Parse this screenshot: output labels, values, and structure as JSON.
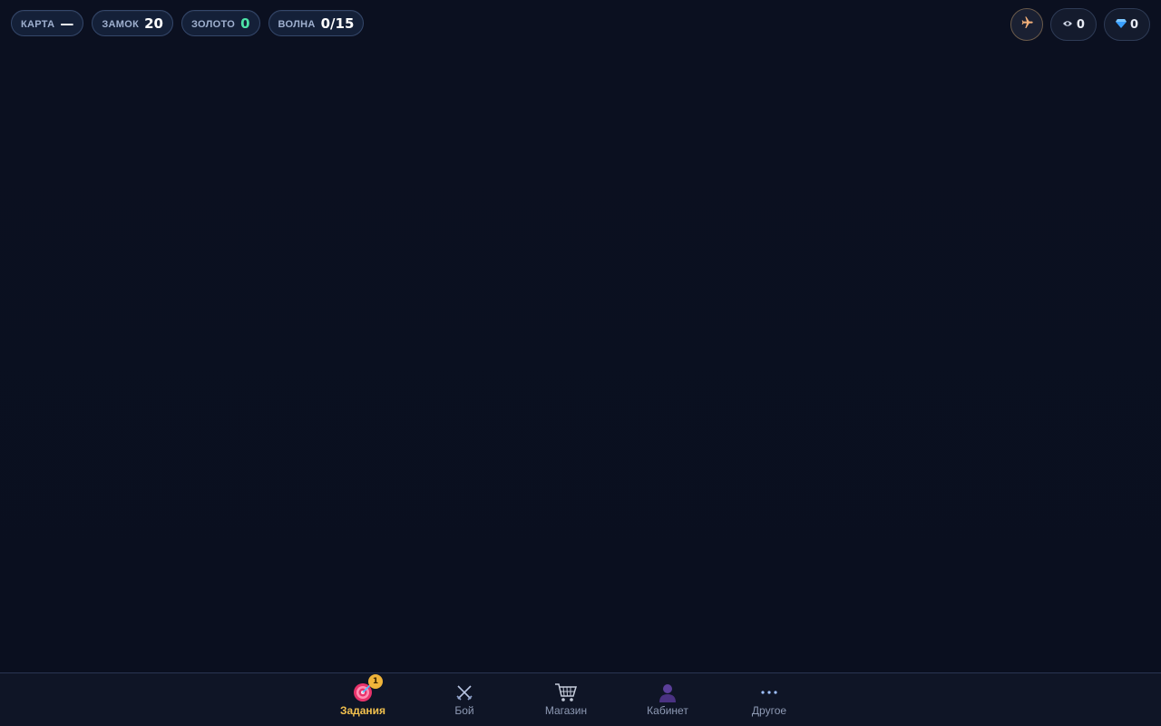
{
  "hud": {
    "stats": [
      {
        "label": "КАРТА",
        "value": "—"
      },
      {
        "label": "ЗАМОК",
        "value": "20"
      },
      {
        "label": "ЗОЛОТО",
        "value": "0"
      },
      {
        "label": "ВОЛНА",
        "value": "0/15"
      }
    ],
    "flight_icon": "airplane-icon",
    "currencies": [
      {
        "icon": "eye-icon",
        "value": "0"
      },
      {
        "icon": "gem-icon",
        "value": "0"
      }
    ]
  },
  "nav": {
    "items": [
      {
        "label": "Задания",
        "icon": "target-icon",
        "badge": "1",
        "active": true
      },
      {
        "label": "Бой",
        "icon": "crossed-swords-icon"
      },
      {
        "label": "Магазин",
        "icon": "cart-icon"
      },
      {
        "label": "Кабинет",
        "icon": "user-icon"
      },
      {
        "label": "Другое",
        "icon": "more-icon"
      }
    ]
  },
  "colors": {
    "background": "#0b1020",
    "accent_active": "#f2c14e",
    "gold_value": "#4de3a6"
  }
}
